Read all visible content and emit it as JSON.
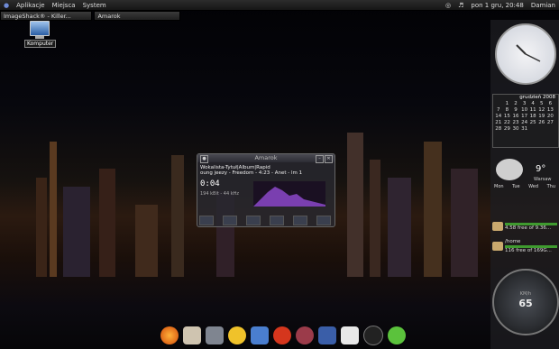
{
  "top_panel": {
    "menu": [
      "Aplikacje",
      "Miejsca",
      "System"
    ],
    "datetime": "pon 1 gru, 20:48",
    "user": "Damian"
  },
  "taskbar": [
    {
      "label": "ImageShack® - Killer..."
    },
    {
      "label": "Amarok"
    }
  ],
  "desktop_icon": {
    "label": "Komputer"
  },
  "amarok": {
    "title": "Amarok",
    "track_line1": "Wokalista-Tytuł|Album|Rapid",
    "track_line2": "oung jeezy - Freedom - 4:23 - Anet - lm 1",
    "time": "0:04",
    "bitrate": "194 kBit - 44 kHz"
  },
  "calendar": {
    "month_year": "grudzień 2008",
    "days": [
      "",
      "1",
      "2",
      "3",
      "4",
      "5",
      "6",
      "7",
      "8",
      "9",
      "10",
      "11",
      "12",
      "13",
      "14",
      "15",
      "16",
      "17",
      "18",
      "19",
      "20",
      "21",
      "22",
      "23",
      "24",
      "25",
      "26",
      "27",
      "28",
      "29",
      "30",
      "31",
      "",
      "",
      ""
    ]
  },
  "weather": {
    "temp": "9°",
    "city": "Warsaw",
    "days": [
      "Mon",
      "Tue",
      "Wed",
      "Thu"
    ]
  },
  "sysmon": {
    "disk1": "4.58 free of 9.36...",
    "disk2_label": "/home",
    "disk2": "116 free of 169G..."
  },
  "gauge": {
    "unit": "KM/h",
    "value": "65"
  },
  "colors": {
    "accent": "#3f9a2f",
    "brand": "#6f8bd6"
  }
}
